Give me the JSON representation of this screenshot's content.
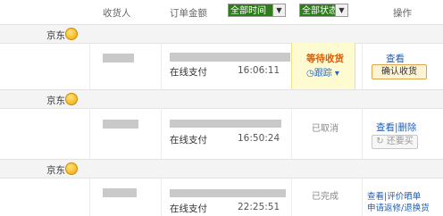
{
  "header": {
    "receiver_label": "收货人",
    "amount_label": "订单金额",
    "time_filter": "全部时间",
    "status_filter": "全部状态",
    "operation_label": "操作"
  },
  "orders": [
    {
      "shop": "京东",
      "payment": "在线支付",
      "time": "16:06:11",
      "status": "等待收货",
      "track": "跟踪",
      "actions": [
        "查看",
        "确认收货"
      ]
    },
    {
      "shop": "京东",
      "payment": "在线支付",
      "time": "16:50:24",
      "status": "已取消",
      "actions": [
        "查看",
        "删除",
        "还要买"
      ]
    },
    {
      "shop": "京东",
      "payment": "在线支付",
      "time": "22:25:51",
      "status": "已完成",
      "actions": [
        "查看",
        "评价晒单",
        "申请返修/退换货"
      ]
    }
  ],
  "colors": {
    "pending_status": "#e05a00",
    "link": "#1f5fb5",
    "pending_bg": "#fffbd1",
    "filter_bg": "#2e7d1a"
  }
}
